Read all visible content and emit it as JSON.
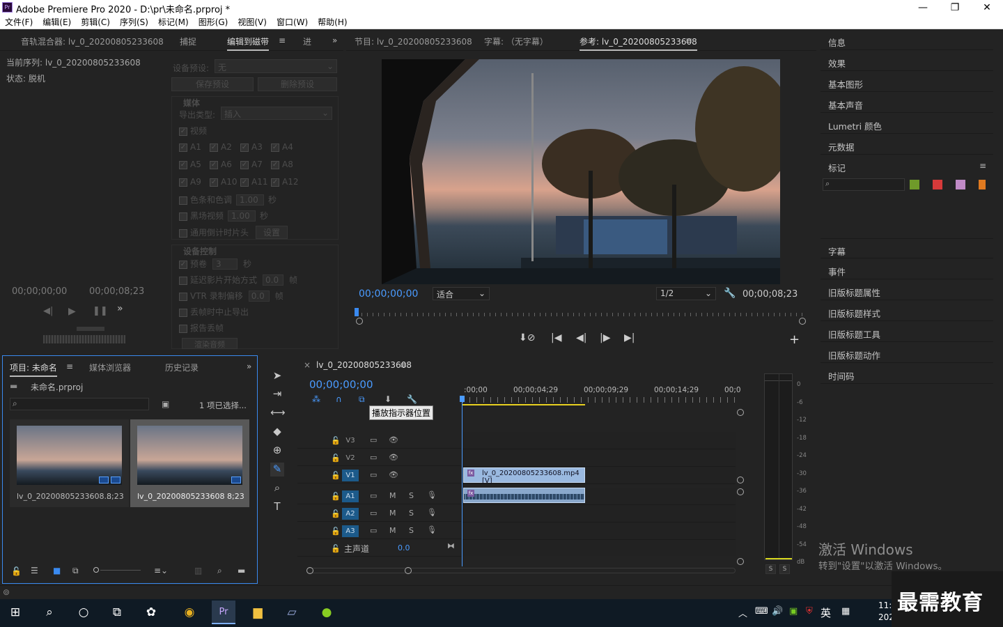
{
  "window": {
    "title": "Adobe Premiere Pro 2020 - D:\\pr\\未命名.prproj *",
    "logo": "Pr",
    "minimize": "—",
    "maximize": "❐",
    "close": "✕"
  },
  "menu": [
    "文件(F)",
    "编辑(E)",
    "剪辑(C)",
    "序列(S)",
    "标记(M)",
    "图形(G)",
    "视图(V)",
    "窗口(W)",
    "帮助(H)"
  ],
  "left_panel": {
    "tabs": [
      "音轨混合器: lv_0_20200805233608",
      "捕捉",
      "编辑到磁带",
      "进"
    ],
    "current_sequence": "当前序列: lv_0_20200805233608",
    "status": "状态: 脱机",
    "tc_left": "00;00;00;00",
    "tc_right": "00;00;08;23",
    "etc": {
      "device_preset_label": "设备预设:",
      "device_preset_value": "无",
      "save_preset": "保存预设",
      "delete_preset": "删除预设",
      "media_section": "媒体",
      "export_type_label": "导出类型:",
      "export_type_value": "插入",
      "video": "视频",
      "audio_tracks": [
        "A1",
        "A2",
        "A3",
        "A4",
        "A5",
        "A6",
        "A7",
        "A8",
        "A9",
        "A10",
        "A11",
        "A12"
      ],
      "color_bars": "色条和色调",
      "color_bars_val": "1.00",
      "sec": "秒",
      "black_video": "黑场视频",
      "black_video_val": "1.00",
      "countdown": "通用倒计时片头",
      "setup": "设置",
      "device_control": "设备控制",
      "preroll": "预卷",
      "preroll_val": "3",
      "delay_start": "延迟影片开始方式",
      "delay_val": "0.0",
      "frames": "帧",
      "vtr_offset": "VTR 录制偏移",
      "vtr_val": "0.0",
      "abort_drop": "丢帧时中止导出",
      "report_drop": "报告丢帧",
      "render_audio": "渲染音频"
    }
  },
  "program": {
    "tabs": [
      "节目: lv_0_20200805233608",
      "字幕: （无字幕）",
      "参考: lv_0_20200805233608"
    ],
    "timecode": "00;00;00;00",
    "fit": "适合",
    "resolution": "1/2",
    "duration": "00;00;08;23"
  },
  "right_panel": {
    "items_top": [
      "信息",
      "效果",
      "基本图形",
      "基本声音",
      "Lumetri 颜色",
      "元数据"
    ],
    "markers": "标记",
    "marker_colors": [
      "#6f9a2a",
      "#d63a3a",
      "#c08ac6",
      "#e07a20"
    ],
    "items_bottom": [
      "字幕",
      "事件",
      "旧版标题属性",
      "旧版标题样式",
      "旧版标题工具",
      "旧版标题动作",
      "时间码"
    ]
  },
  "project": {
    "tabs": [
      "项目: 未命名",
      "媒体浏览器",
      "历史记录"
    ],
    "file": "未命名.prproj",
    "selected": "1 项已选择...",
    "items": [
      {
        "name": "lv_0_20200805233608...",
        "dur": "8;23"
      },
      {
        "name": "lv_0_20200805233608",
        "dur": "8;23"
      }
    ]
  },
  "timeline": {
    "tab": "lv_0_20200805233608",
    "timecode": "00;00;00;00",
    "tooltip": "播放指示器位置",
    "ruler": [
      ":00;00",
      "00;00;04;29",
      "00;00;09;29",
      "00;00;14;29",
      "00;0"
    ],
    "video_tracks": [
      "V3",
      "V2",
      "V1"
    ],
    "audio_tracks": [
      "A1",
      "A2",
      "A3"
    ],
    "master": "主声道",
    "master_val": "0.0",
    "clip_video": "lv_0_20200805233608.mp4 [V]",
    "m": "M",
    "s": "S",
    "fx": "fx"
  },
  "meter": {
    "scale": [
      "0",
      "-6",
      "-12",
      "-18",
      "-24",
      "-30",
      "-36",
      "-42",
      "-48",
      "-54",
      "dB"
    ],
    "solo": "S"
  },
  "watermark": {
    "line1": "激活 Windows",
    "line2": "转到\"设置\"以激活 Windows。",
    "brand": "最需教育"
  },
  "taskbar": {
    "lang": "英",
    "time": "11:",
    "year": "202"
  }
}
